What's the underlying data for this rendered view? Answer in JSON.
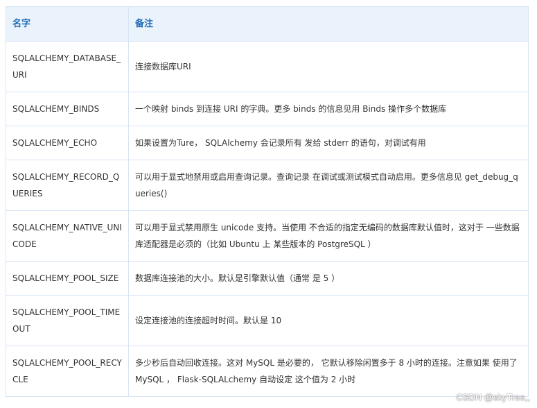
{
  "table": {
    "headers": {
      "name": "名字",
      "note": "备注"
    },
    "rows": [
      {
        "name": "SQLALCHEMY_DATABASE_URI",
        "note": "连接数据库URI"
      },
      {
        "name": "SQLALCHEMY_BINDS",
        "note": "一个映射 binds 到连接 URI 的字典。更多 binds 的信息见用 Binds 操作多个数据库"
      },
      {
        "name": "SQLALCHEMY_ECHO",
        "note": "如果设置为Ture， SQLAlchemy 会记录所有 发给 stderr 的语句，对调试有用"
      },
      {
        "name": "SQLALCHEMY_RECORD_QUERIES",
        "note": "可以用于显式地禁用或启用查询记录。查询记录 在调试或测试模式自动启用。更多信息见 get_debug_queries()"
      },
      {
        "name": "SQLALCHEMY_NATIVE_UNICODE",
        "note": "可以用于显式禁用原生 unicode 支持。当使用 不合适的指定无编码的数据库默认值时，这对于 一些数据库适配器是必须的（比如 Ubuntu 上 某些版本的 PostgreSQL ）"
      },
      {
        "name": "SQLALCHEMY_POOL_SIZE",
        "note": "数据库连接池的大小。默认是引擎默认值（通常 是 5 ）"
      },
      {
        "name": "SQLALCHEMY_POOL_TIMEOUT",
        "note": "设定连接池的连接超时时间。默认是 10"
      },
      {
        "name": "SQLALCHEMY_POOL_RECYCLE",
        "note": "多少秒后自动回收连接。这对 MySQL 是必要的， 它默认移除闲置多于 8 小时的连接。注意如果 使用了 MySQL ， Flask-SQLALchemy 自动设定 这个值为 2 小时"
      }
    ]
  },
  "watermark": "CSDN @skyTree,,"
}
